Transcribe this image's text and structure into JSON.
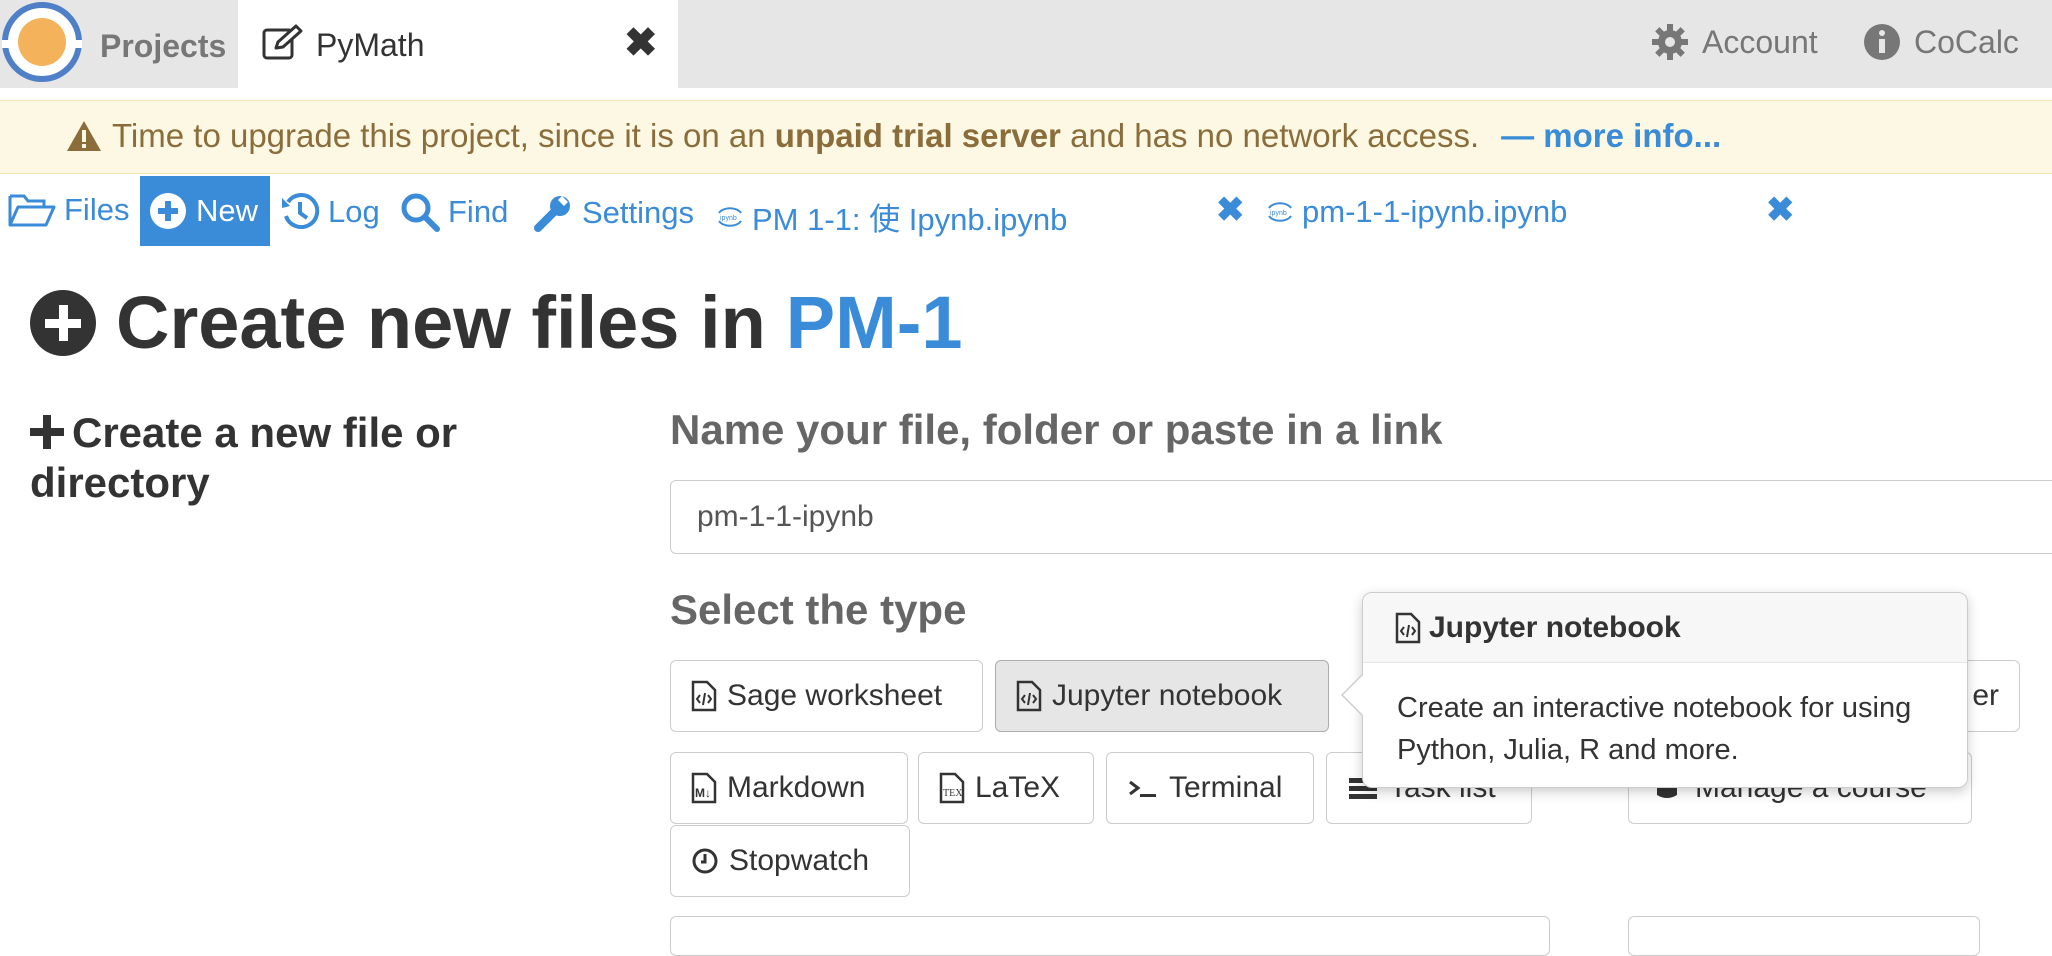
{
  "topbar": {
    "projects_label": "Projects",
    "project_tab_title": "PyMath",
    "close_symbol": "✖",
    "account_label": "Account",
    "cocalc_label": "CoCalc"
  },
  "banner": {
    "text_before": "Time to upgrade this project, since it is on an",
    "bold_text": "unpaid trial server",
    "text_after": "and has no network access.",
    "more_info": "— more info..."
  },
  "filenav": {
    "files": "Files",
    "new": "New",
    "log": "Log",
    "find": "Find",
    "settings": "Settings",
    "open_file_1": "PM 1-1: 使 Ipynb.ipynb",
    "open_file_2": "pm-1-1-ipynb.ipynb",
    "close_symbol": "✖"
  },
  "heading": {
    "prefix": "Create new files in",
    "project": "PM-1"
  },
  "left": {
    "create_label": "Create a new file or directory"
  },
  "form": {
    "name_label": "Name your file, folder or paste in a link",
    "name_value": "pm-1-1-ipynb",
    "type_label": "Select the type"
  },
  "types": {
    "sage": "Sage worksheet",
    "jupyter": "Jupyter notebook",
    "folder_partial": "er",
    "markdown": "Markdown",
    "latex": "LaTeX",
    "terminal": "Terminal",
    "task_list": "Task list",
    "course": "Manage a course",
    "stopwatch": "Stopwatch"
  },
  "popover": {
    "title": "Jupyter notebook",
    "body": "Create an interactive notebook for using Python, Julia, R and more."
  },
  "colors": {
    "accent": "#3a8bd8",
    "warning_bg": "#fcf8e3",
    "warning_text": "#8a6d3b",
    "logo_orange": "#f4b35a",
    "logo_blue": "#4e7fc7"
  }
}
